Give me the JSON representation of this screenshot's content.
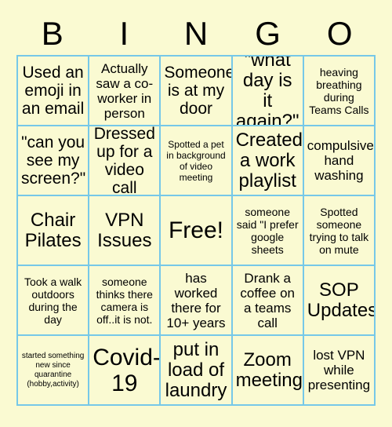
{
  "card": {
    "title_letters": [
      "B",
      "I",
      "N",
      "G",
      "O"
    ],
    "colors": {
      "background": "#FAFAD2",
      "cell_background": "#FAFAD2",
      "grid_border": "#76C8E8",
      "text": "#000000"
    },
    "grid": {
      "columns": 5,
      "rows": 5,
      "free_space": {
        "row": 2,
        "col": 2,
        "label": "Free!"
      }
    },
    "cells": [
      [
        {
          "text": "Used an emoji in an email",
          "size": "lg"
        },
        {
          "text": "Actually saw a co-worker in person",
          "size": "md"
        },
        {
          "text": "Someone is at my door",
          "size": "lg"
        },
        {
          "text": "\"what day is it again?\"",
          "size": "xl"
        },
        {
          "text": "heaving breathing during Teams Calls",
          "size": "sm"
        }
      ],
      [
        {
          "text": "\"can you see my screen?\"",
          "size": "lg"
        },
        {
          "text": "Dressed up for a video call",
          "size": "lg"
        },
        {
          "text": "Spotted a pet in background of video meeting",
          "size": "xs"
        },
        {
          "text": "Created a work playlist",
          "size": "xl"
        },
        {
          "text": "compulsive hand washing",
          "size": "md"
        }
      ],
      [
        {
          "text": "Chair Pilates",
          "size": "xl"
        },
        {
          "text": "VPN Issues",
          "size": "xl"
        },
        {
          "text": "Free!",
          "size": "xxl"
        },
        {
          "text": "someone said \"I prefer google sheets",
          "size": "sm"
        },
        {
          "text": "Spotted someone trying to talk on mute",
          "size": "sm"
        }
      ],
      [
        {
          "text": "Took a walk outdoors during the day",
          "size": "sm"
        },
        {
          "text": "someone thinks there camera is off..it is not.",
          "size": "sm"
        },
        {
          "text": "has worked there for 10+ years",
          "size": "md"
        },
        {
          "text": "Drank a coffee on a teams call",
          "size": "md"
        },
        {
          "text": "SOP Updates",
          "size": "xl"
        }
      ],
      [
        {
          "text": "started something new since quarantine (hobby,activity)",
          "size": "xxs"
        },
        {
          "text": "Covid-19",
          "size": "xxl"
        },
        {
          "text": "put in load of laundry",
          "size": "xl"
        },
        {
          "text": "Zoom meeting",
          "size": "xl"
        },
        {
          "text": "lost VPN while presenting",
          "size": "md"
        }
      ]
    ]
  }
}
